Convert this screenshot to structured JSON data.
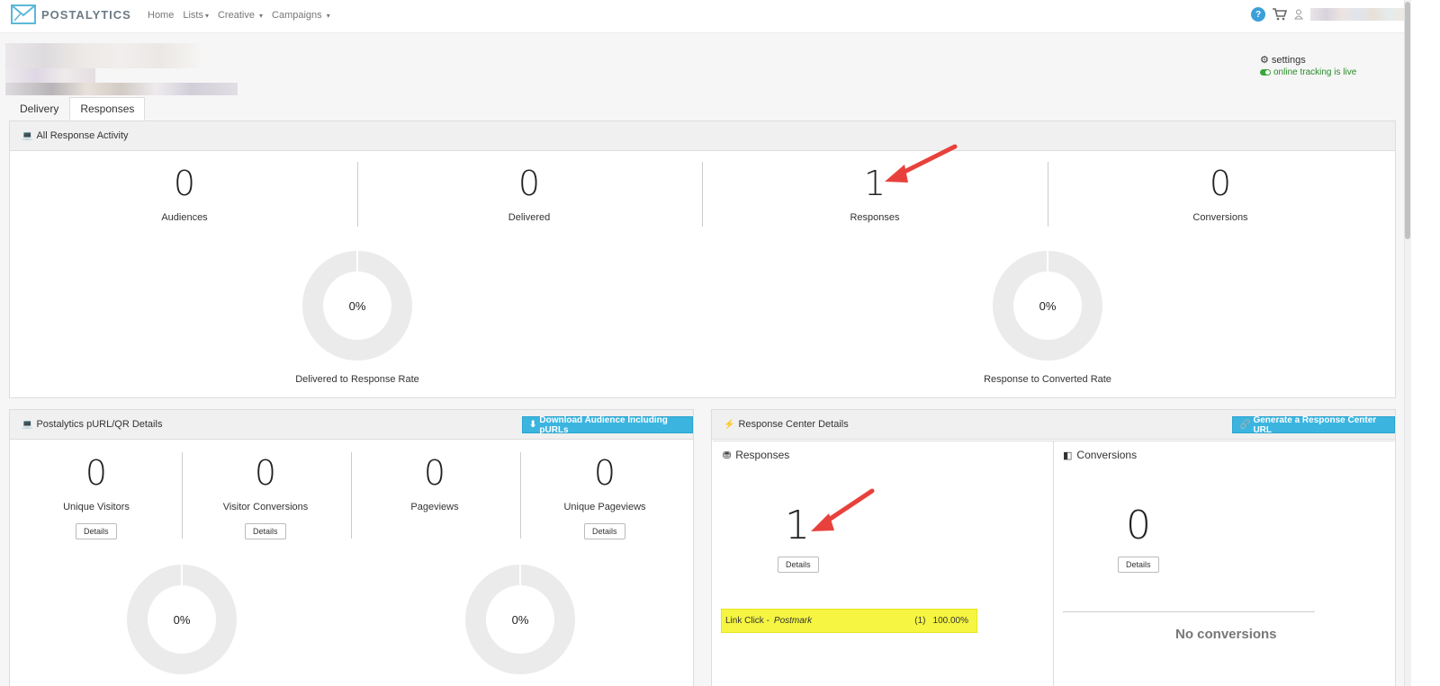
{
  "nav": {
    "brand": "POSTALYTICS",
    "links": [
      {
        "label": "Home"
      },
      {
        "label": "Lists"
      },
      {
        "label": "Creative"
      },
      {
        "label": "Campaigns"
      }
    ],
    "help_glyph": "?"
  },
  "header": {
    "settings_label": "settings",
    "tracking_label": "online tracking is live"
  },
  "tabs": [
    {
      "label": "Delivery"
    },
    {
      "label": "Responses"
    }
  ],
  "activity": {
    "title": "All Response Activity",
    "stats": [
      {
        "value": "0",
        "label": "Audiences"
      },
      {
        "value": "0",
        "label": "Delivered"
      },
      {
        "value": "1",
        "label": "Responses"
      },
      {
        "value": "0",
        "label": "Conversions"
      }
    ],
    "donuts": [
      {
        "value": "0%",
        "caption": "Delivered to Response Rate"
      },
      {
        "value": "0%",
        "caption": "Response to Converted Rate"
      }
    ]
  },
  "purl": {
    "title": "Postalytics pURL/QR Details",
    "download_button": "Download Audience Including pURLs",
    "stats": [
      {
        "value": "0",
        "label": "Unique Visitors",
        "button": "Details"
      },
      {
        "value": "0",
        "label": "Visitor Conversions",
        "button": "Details"
      },
      {
        "value": "0",
        "label": "Pageviews"
      },
      {
        "value": "0",
        "label": "Unique Pageviews",
        "button": "Details"
      }
    ],
    "donuts": [
      {
        "value": "0%"
      },
      {
        "value": "0%"
      }
    ]
  },
  "response_center": {
    "title": "Response Center Details",
    "generate_button": "Generate a Response Center URL",
    "responses": {
      "title": "Responses",
      "value": "1",
      "button": "Details",
      "link_row": {
        "label": "Link Click -",
        "source": "Postmark",
        "count": "(1)",
        "percent": "100.00%"
      }
    },
    "conversions": {
      "title": "Conversions",
      "value": "0",
      "button": "Details",
      "empty_text": "No conversions"
    }
  },
  "colors": {
    "accent": "#3bb5e0",
    "highlight": "#f5f542",
    "arrow": "#e8413c",
    "tracking_green": "#2a8a2a"
  }
}
